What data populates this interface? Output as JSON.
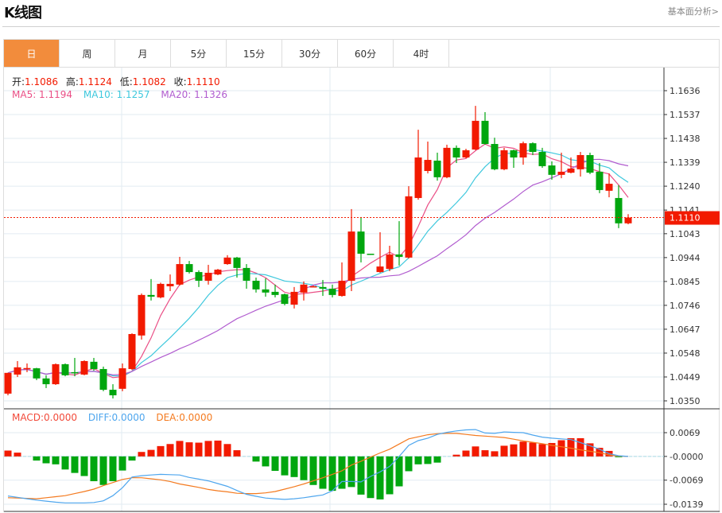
{
  "header": {
    "title": "K线图",
    "link": "基本面分析>"
  },
  "tabs": [
    {
      "label": "日",
      "active": true
    },
    {
      "label": "周"
    },
    {
      "label": "月"
    },
    {
      "label": "5分"
    },
    {
      "label": "15分"
    },
    {
      "label": "30分"
    },
    {
      "label": "60分"
    },
    {
      "label": "4时"
    }
  ],
  "ohlc_legend": {
    "open_label": "开:",
    "open": "1.1086",
    "high_label": "高:",
    "high": "1.1124",
    "low_label": "低:",
    "low": "1.1082",
    "close_label": "收:",
    "close": "1.1110"
  },
  "ma_legend": {
    "ma5": "MA5: 1.1194",
    "ma10": "MA10: 1.1257",
    "ma20": "MA20: 1.1326"
  },
  "macd_legend": {
    "macd": "MACD:0.0000",
    "diff": "DIFF:0.0000",
    "dea": "DEA:0.0000"
  },
  "colors": {
    "up": "#f21a00",
    "down": "#00a60e",
    "ma5": "#ea4f86",
    "ma10": "#3ec8dd",
    "ma20": "#b15ccf",
    "diff": "#4ea6ee",
    "dea": "#f47a1f",
    "active_tab": "#f28c3c"
  },
  "chart_data": [
    {
      "type": "candlestick",
      "title": "K线图 日",
      "ylim": [
        1.035,
        1.1636
      ],
      "y_ticks": [
        "1.1636",
        "1.1537",
        "1.1438",
        "1.1339",
        "1.1240",
        "1.1141",
        "1.1043",
        "1.0944",
        "1.0845",
        "1.0746",
        "1.0647",
        "1.0548",
        "1.0449",
        "1.0350"
      ],
      "last_price": "1.1110",
      "ma_periods": [
        5,
        10,
        20
      ],
      "ohlc": [
        [
          1.038,
          1.0466,
          1.0373,
          1.0466
        ],
        [
          1.0459,
          1.0515,
          1.0449,
          1.0489
        ],
        [
          1.0484,
          1.0505,
          1.0469,
          1.0486
        ],
        [
          1.0485,
          1.0487,
          1.0436,
          1.0443
        ],
        [
          1.0443,
          1.0456,
          1.0403,
          1.0419
        ],
        [
          1.0419,
          1.0505,
          1.0416,
          1.0502
        ],
        [
          1.0502,
          1.0505,
          1.0452,
          1.0456
        ],
        [
          1.0469,
          1.0528,
          1.0452,
          1.0466
        ],
        [
          1.0459,
          1.0518,
          1.0456,
          1.0515
        ],
        [
          1.0512,
          1.0528,
          1.0475,
          1.0482
        ],
        [
          1.0482,
          1.0492,
          1.039,
          1.0396
        ],
        [
          1.0396,
          1.0419,
          1.036,
          1.0373
        ],
        [
          1.04,
          1.0505,
          1.039,
          1.0485
        ],
        [
          1.0482,
          1.063,
          1.0478,
          1.0627
        ],
        [
          1.0621,
          1.0795,
          1.0604,
          1.0789
        ],
        [
          1.0789,
          1.0855,
          1.0766,
          1.0782
        ],
        [
          1.0779,
          1.084,
          1.0775,
          1.0835
        ],
        [
          1.0825,
          1.0874,
          1.0805,
          1.0835
        ],
        [
          1.0832,
          1.0947,
          1.0828,
          1.0917
        ],
        [
          1.0917,
          1.093,
          1.0878,
          1.0884
        ],
        [
          1.0884,
          1.0891,
          1.0822,
          1.0848
        ],
        [
          1.0848,
          1.0914,
          1.0832,
          1.0881
        ],
        [
          1.0874,
          1.0897,
          1.0871,
          1.0894
        ],
        [
          1.0917,
          1.0954,
          1.0914,
          1.0944
        ],
        [
          1.0944,
          1.0947,
          1.0861,
          1.0901
        ],
        [
          1.0901,
          1.0917,
          1.0815,
          1.0848
        ],
        [
          1.0848,
          1.0861,
          1.0799,
          1.0812
        ],
        [
          1.0812,
          1.0858,
          1.0782,
          1.0799
        ],
        [
          1.0802,
          1.0832,
          1.0779,
          1.0789
        ],
        [
          1.0792,
          1.0795,
          1.0746,
          1.0752
        ],
        [
          1.0749,
          1.0822,
          1.0733,
          1.0802
        ],
        [
          1.0799,
          1.0845,
          1.0766,
          1.0832
        ],
        [
          1.0825,
          1.0828,
          1.0822,
          1.0825
        ],
        [
          1.0822,
          1.0851,
          1.0785,
          1.0815
        ],
        [
          1.0815,
          1.0832,
          1.0779,
          1.0789
        ],
        [
          1.0785,
          1.0924,
          1.0782,
          1.0848
        ],
        [
          1.0848,
          1.1145,
          1.0805,
          1.1052
        ],
        [
          1.1052,
          1.1112,
          1.0924,
          1.096
        ],
        [
          1.096,
          1.096,
          1.0955,
          1.0957
        ],
        [
          1.0884,
          1.1049,
          1.0881,
          1.0907
        ],
        [
          1.0897,
          1.0993,
          1.0888,
          1.0957
        ],
        [
          1.0957,
          1.1095,
          1.0911,
          1.0947
        ],
        [
          1.0944,
          1.124,
          1.094,
          1.1198
        ],
        [
          1.1191,
          1.1474,
          1.1184,
          1.1359
        ],
        [
          1.1303,
          1.1425,
          1.1293,
          1.1349
        ],
        [
          1.1346,
          1.1379,
          1.1263,
          1.1277
        ],
        [
          1.1277,
          1.1412,
          1.1273,
          1.1399
        ],
        [
          1.1399,
          1.1409,
          1.1336,
          1.1359
        ],
        [
          1.1359,
          1.1395,
          1.1356,
          1.1389
        ],
        [
          1.1392,
          1.1573,
          1.1389,
          1.1511
        ],
        [
          1.1511,
          1.1547,
          1.1412,
          1.1415
        ],
        [
          1.1415,
          1.1441,
          1.1306,
          1.131
        ],
        [
          1.131,
          1.1399,
          1.1306,
          1.1389
        ],
        [
          1.1389,
          1.1392,
          1.1316,
          1.1359
        ],
        [
          1.1359,
          1.1425,
          1.1329,
          1.1418
        ],
        [
          1.1418,
          1.1422,
          1.1369,
          1.1382
        ],
        [
          1.1382,
          1.1399,
          1.1316,
          1.1323
        ],
        [
          1.1326,
          1.1343,
          1.1267,
          1.1287
        ],
        [
          1.1287,
          1.1379,
          1.1273,
          1.13
        ],
        [
          1.1296,
          1.1359,
          1.1293,
          1.1313
        ],
        [
          1.131,
          1.1382,
          1.128,
          1.1369
        ],
        [
          1.1369,
          1.1379,
          1.129,
          1.1296
        ],
        [
          1.13,
          1.1336,
          1.1211,
          1.1224
        ],
        [
          1.1221,
          1.1293,
          1.1194,
          1.125
        ],
        [
          1.1191,
          1.1244,
          1.1066,
          1.1086
        ],
        [
          1.1086,
          1.1124,
          1.1082,
          1.111
        ]
      ]
    },
    {
      "type": "macd",
      "ylim": [
        -0.0139,
        0.0069
      ],
      "y_ticks": [
        "0.0069",
        "-0.0000",
        "-0.0069",
        "-0.0139"
      ],
      "histogram": [
        0.0017,
        0.0011,
        0,
        -0.0012,
        -0.002,
        -0.0023,
        -0.0038,
        -0.0048,
        -0.0057,
        -0.0072,
        -0.0083,
        -0.0072,
        -0.0041,
        -0.0012,
        0.0013,
        0.0019,
        0.003,
        0.0036,
        0.0045,
        0.0041,
        0.004,
        0.0045,
        0.0046,
        0.0036,
        0.0018,
        0,
        -0.0015,
        -0.0029,
        -0.0042,
        -0.0055,
        -0.006,
        -0.0069,
        -0.0083,
        -0.0094,
        -0.01,
        -0.0094,
        -0.0089,
        -0.0111,
        -0.0121,
        -0.0125,
        -0.011,
        -0.0087,
        -0.0043,
        -0.0023,
        -0.0022,
        -0.0018,
        0,
        0.0005,
        0.0017,
        0.0029,
        0.0018,
        0.0015,
        0.0031,
        0.0035,
        0.0043,
        0.004,
        0.0036,
        0.0039,
        0.0047,
        0.0053,
        0.0053,
        0.0038,
        0.0025,
        0.0016,
        -0.0001,
        0
      ],
      "diff": [
        -0.0115,
        -0.0119,
        -0.0123,
        -0.0127,
        -0.013,
        -0.0133,
        -0.0135,
        -0.0135,
        -0.0135,
        -0.0134,
        -0.0129,
        -0.0114,
        -0.0091,
        -0.006,
        -0.0056,
        -0.0054,
        -0.0052,
        -0.0053,
        -0.0054,
        -0.0061,
        -0.0066,
        -0.0071,
        -0.0079,
        -0.0087,
        -0.0099,
        -0.011,
        -0.0116,
        -0.0121,
        -0.0123,
        -0.0125,
        -0.0123,
        -0.012,
        -0.0116,
        -0.0112,
        -0.01,
        -0.0073,
        -0.0073,
        -0.0074,
        -0.0058,
        -0.0045,
        -0.0029,
        0.0,
        0.0032,
        0.0046,
        0.0053,
        0.0064,
        0.007,
        0.0074,
        0.0077,
        0.0078,
        0.0068,
        0.0067,
        0.0071,
        0.007,
        0.0069,
        0.0062,
        0.0056,
        0.0053,
        0.0051,
        0.0049,
        0.004,
        0.0031,
        0.0021,
        0.0008,
        0.0002,
        0.0
      ],
      "dea": [
        -0.012,
        -0.0121,
        -0.0122,
        -0.0123,
        -0.012,
        -0.0117,
        -0.0114,
        -0.0108,
        -0.0102,
        -0.0095,
        -0.0085,
        -0.0076,
        -0.0067,
        -0.0062,
        -0.0062,
        -0.0065,
        -0.0068,
        -0.0073,
        -0.008,
        -0.0085,
        -0.009,
        -0.0096,
        -0.01,
        -0.0103,
        -0.0107,
        -0.0108,
        -0.0108,
        -0.0106,
        -0.0102,
        -0.0095,
        -0.0088,
        -0.008,
        -0.0071,
        -0.0062,
        -0.0052,
        -0.0042,
        -0.0025,
        -0.0014,
        -0.0002,
        0.001,
        0.0021,
        0.0036,
        0.0051,
        0.0057,
        0.0063,
        0.0066,
        0.0067,
        0.0067,
        0.0064,
        0.0061,
        0.0059,
        0.0057,
        0.0055,
        0.005,
        0.0045,
        0.0041,
        0.0037,
        0.0032,
        0.0028,
        0.0024,
        0.0019,
        0.0015,
        0.0011,
        0.0004,
        0.0001,
        0.0
      ]
    }
  ]
}
